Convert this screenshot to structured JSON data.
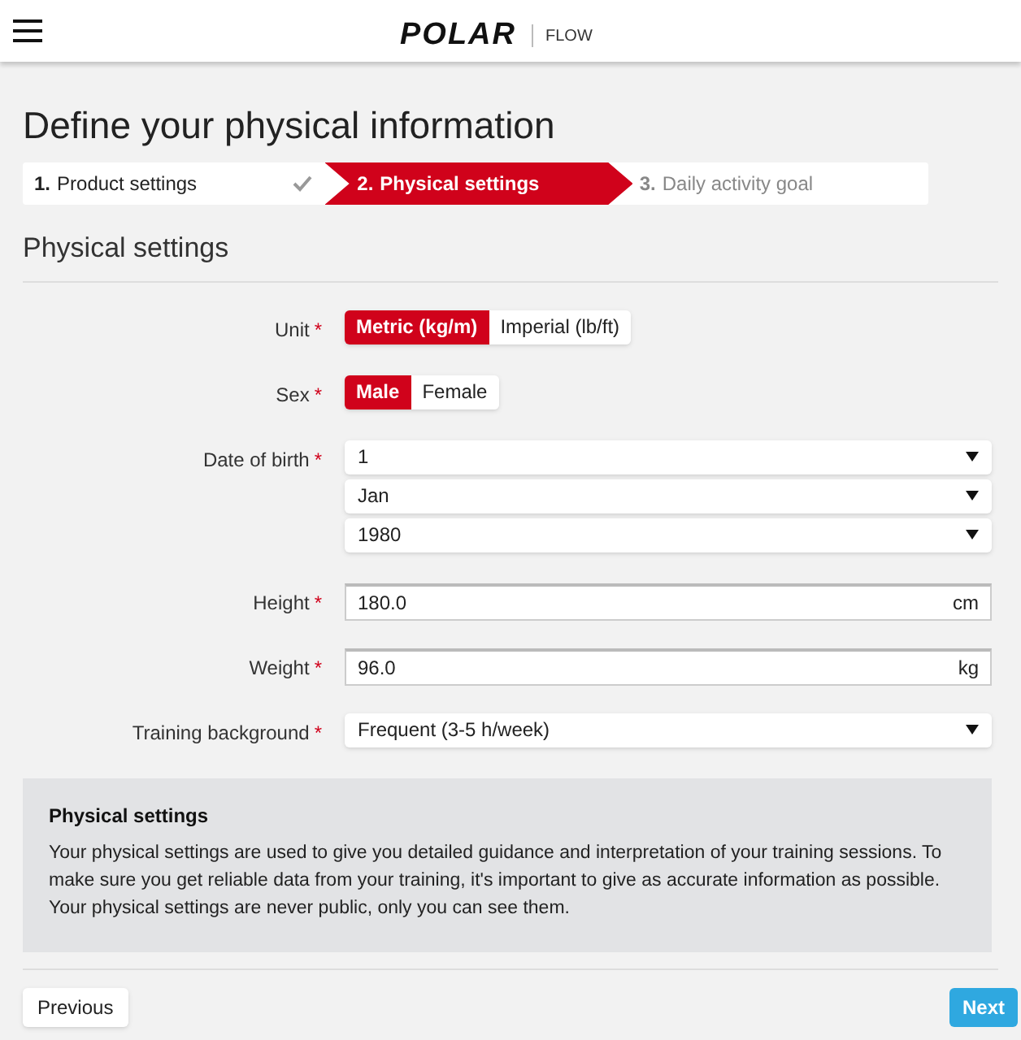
{
  "header": {
    "logo": "POLAR",
    "product": "FLOW"
  },
  "title": "Define your physical information",
  "steps": [
    {
      "number": "1.",
      "label": "Product settings",
      "selected": false,
      "done": true
    },
    {
      "number": "2.",
      "label": "Physical settings",
      "selected": true,
      "done": false
    },
    {
      "number": "3.",
      "label": "Daily activity goal",
      "selected": false,
      "done": false
    }
  ],
  "section_title": "Physical settings",
  "form": [
    {
      "kind": "toggle",
      "label": "Unit",
      "required": "*",
      "options": [
        {
          "label": "Metric (kg/m)",
          "selected": true
        },
        {
          "label": "Imperial (lb/ft)",
          "selected": false
        }
      ]
    },
    {
      "kind": "toggle",
      "label": "Sex",
      "required": "*",
      "options": [
        {
          "label": "Male",
          "selected": true
        },
        {
          "label": "Female",
          "selected": false
        }
      ]
    },
    {
      "kind": "selects",
      "label": "Date of birth",
      "required": "*",
      "values": [
        "1",
        "Jan",
        "1980"
      ]
    },
    {
      "kind": "input",
      "label": "Height",
      "required": "*",
      "value": "180.0",
      "unit": "cm"
    },
    {
      "kind": "input",
      "label": "Weight",
      "required": "*",
      "value": "96.0",
      "unit": "kg"
    },
    {
      "kind": "selects",
      "label": "Training background",
      "required": "*",
      "values": [
        "Frequent (3-5 h/week)"
      ]
    }
  ],
  "info": {
    "title": "Physical settings",
    "text": "Your physical settings are used to give you detailed guidance and interpretation of your training sessions. To make sure you get reliable data from your training, it's important to give as accurate information as possible. Your physical settings are never public, only you can see them."
  },
  "buttons": {
    "previous": "Previous",
    "next": "Next"
  }
}
